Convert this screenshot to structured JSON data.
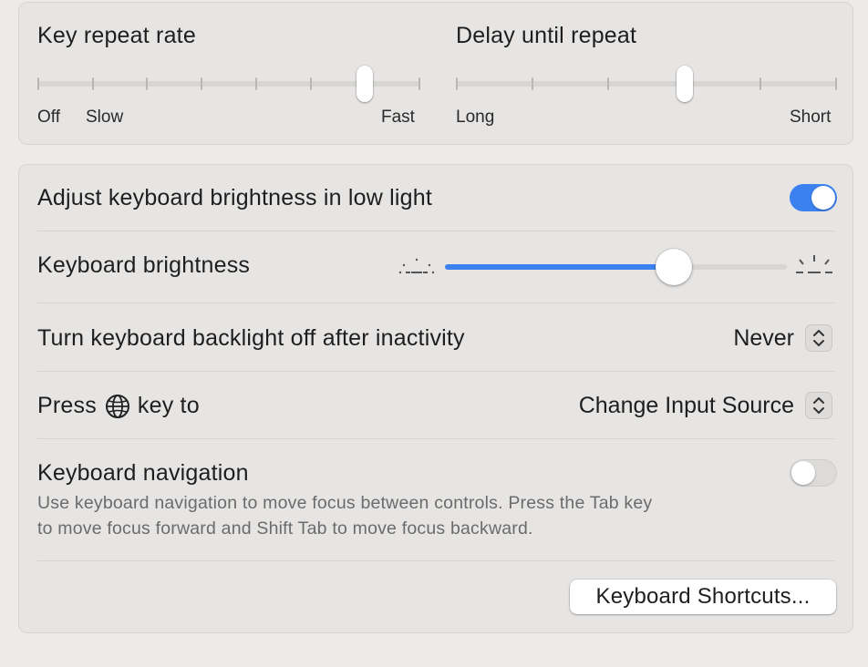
{
  "key_repeat": {
    "title": "Key repeat rate",
    "label_off": "Off",
    "label_slow": "Slow",
    "label_fast": "Fast",
    "tick_count": 8,
    "selected_index": 6
  },
  "delay_repeat": {
    "title": "Delay until repeat",
    "label_long": "Long",
    "label_short": "Short",
    "tick_count": 6,
    "selected_position": 0.6
  },
  "adjust_brightness": {
    "label": "Adjust keyboard brightness in low light",
    "enabled": true
  },
  "keyboard_brightness": {
    "label": "Keyboard brightness",
    "value": 0.67,
    "low_icon": "dim-sun-icon",
    "high_icon": "bright-sun-icon"
  },
  "backlight_off": {
    "label": "Turn keyboard backlight off after inactivity",
    "value": "Never"
  },
  "press_key": {
    "label_before": "Press",
    "label_after": "key to",
    "icon": "globe-icon",
    "value": "Change Input Source"
  },
  "keyboard_navigation": {
    "label": "Keyboard navigation",
    "description_line1": "Use keyboard navigation to move focus between controls. Press the Tab key",
    "description_line2": "to move focus forward and Shift Tab to move focus backward.",
    "enabled": false
  },
  "shortcuts_button": {
    "label": "Keyboard Shortcuts..."
  },
  "colors": {
    "accent": "#3b82f0",
    "background": "#ecebea",
    "panel": "#e6e5e4"
  }
}
